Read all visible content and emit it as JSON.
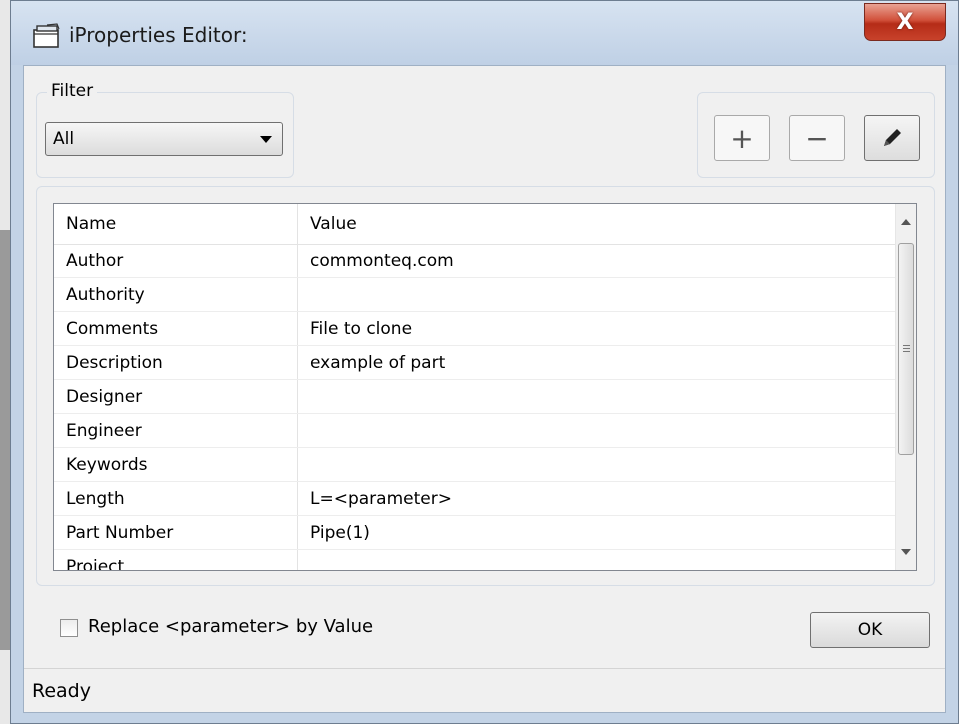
{
  "window": {
    "title": "iProperties Editor:",
    "close_label": "X"
  },
  "filter": {
    "legend": "Filter",
    "selected": "All"
  },
  "toolbar": {
    "add_label": "+",
    "remove_label": "−"
  },
  "grid": {
    "columns": [
      "Name",
      "Value"
    ],
    "rows": [
      {
        "name": "Author",
        "value": "commonteq.com"
      },
      {
        "name": "Authority",
        "value": ""
      },
      {
        "name": "Comments",
        "value": "File to clone"
      },
      {
        "name": "Description",
        "value": "example of part"
      },
      {
        "name": "Designer",
        "value": ""
      },
      {
        "name": "Engineer",
        "value": ""
      },
      {
        "name": "Keywords",
        "value": ""
      },
      {
        "name": "Length",
        "value": "L=<parameter>"
      },
      {
        "name": "Part Number",
        "value": "Pipe(1)"
      },
      {
        "name": "Project",
        "value": ""
      }
    ]
  },
  "replace_checkbox": {
    "label": "Replace <parameter> by Value",
    "checked": false
  },
  "ok_label": "OK",
  "status": "Ready"
}
